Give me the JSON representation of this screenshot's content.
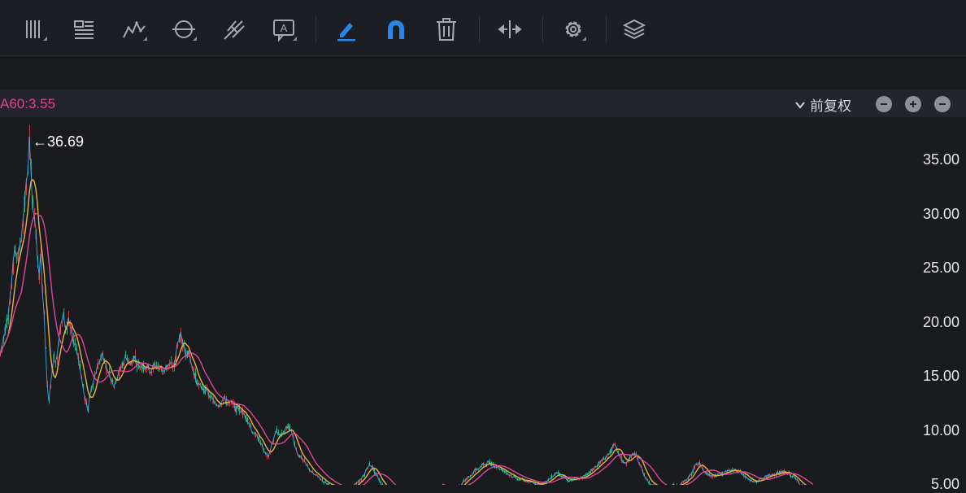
{
  "toolbar": {
    "tools": [
      {
        "name": "vertical-lines-icon",
        "has_menu": true
      },
      {
        "name": "text-lines-icon",
        "has_menu": false
      },
      {
        "name": "polyline-icon",
        "has_menu": true
      },
      {
        "name": "circle-icon",
        "has_menu": true
      },
      {
        "name": "fork-icon",
        "has_menu": false
      },
      {
        "name": "text-annotation-icon",
        "has_menu": true
      },
      {
        "name": "pen-icon",
        "has_menu": false,
        "active": true
      },
      {
        "name": "magnet-icon",
        "has_menu": false,
        "active": true
      },
      {
        "name": "trash-icon",
        "has_menu": false
      },
      {
        "name": "split-arrows-icon",
        "has_menu": false
      },
      {
        "name": "gear-icon",
        "has_menu": true
      },
      {
        "name": "layers-icon",
        "has_menu": false
      }
    ],
    "active_color": "#2a87e8",
    "icon_color": "#a6a8b0"
  },
  "indicator_bar": {
    "ma60_label": "A60:3.55",
    "ma60_color": "#e0459a",
    "adjust_label": "前复权",
    "buttons": [
      "minus-circle-icon",
      "plus-circle-icon",
      "minus-circle-icon"
    ]
  },
  "chart_data": {
    "type": "candlestick",
    "peak_label": "←36.69",
    "yaxis_ticks": [
      "35.00",
      "30.00",
      "25.00",
      "20.00",
      "15.00",
      "10.00",
      "5.00"
    ],
    "ylim": [
      4.5,
      38.5
    ],
    "series": [
      {
        "color": "#e0459a"
      },
      {
        "color": "#e6b43c"
      },
      {
        "color": "#3fa3e8"
      }
    ],
    "price_path": [
      [
        0,
        17
      ],
      [
        5,
        19
      ],
      [
        10,
        21
      ],
      [
        15,
        24
      ],
      [
        18,
        27
      ],
      [
        22,
        26
      ],
      [
        26,
        28
      ],
      [
        30,
        31
      ],
      [
        33,
        33
      ],
      [
        36,
        36.69
      ],
      [
        39,
        32
      ],
      [
        42,
        30
      ],
      [
        45,
        27
      ],
      [
        48,
        24
      ],
      [
        50,
        26
      ],
      [
        53,
        22
      ],
      [
        56,
        18
      ],
      [
        58,
        14
      ],
      [
        60,
        13
      ],
      [
        63,
        15
      ],
      [
        66,
        17
      ],
      [
        69,
        16
      ],
      [
        72,
        18
      ],
      [
        75,
        20
      ],
      [
        78,
        21
      ],
      [
        81,
        19
      ],
      [
        84,
        20
      ],
      [
        88,
        19
      ],
      [
        92,
        18
      ],
      [
        96,
        17
      ],
      [
        100,
        15
      ],
      [
        104,
        13
      ],
      [
        108,
        12
      ],
      [
        112,
        14
      ],
      [
        116,
        15
      ],
      [
        120,
        16
      ],
      [
        125,
        17
      ],
      [
        130,
        16
      ],
      [
        135,
        15
      ],
      [
        140,
        14
      ],
      [
        145,
        15
      ],
      [
        150,
        16
      ],
      [
        155,
        17
      ],
      [
        160,
        16
      ],
      [
        165,
        17
      ],
      [
        170,
        16
      ],
      [
        175,
        16
      ],
      [
        180,
        16
      ],
      [
        185,
        15.5
      ],
      [
        190,
        16
      ],
      [
        195,
        16
      ],
      [
        200,
        15.5
      ],
      [
        205,
        16
      ],
      [
        210,
        16
      ],
      [
        215,
        16
      ],
      [
        218,
        18
      ],
      [
        221,
        19
      ],
      [
        224,
        18
      ],
      [
        228,
        17.5
      ],
      [
        232,
        17
      ],
      [
        236,
        16
      ],
      [
        240,
        15
      ],
      [
        245,
        14
      ],
      [
        250,
        14
      ],
      [
        255,
        13.5
      ],
      [
        260,
        13
      ],
      [
        265,
        12.5
      ],
      [
        270,
        12.5
      ],
      [
        275,
        13
      ],
      [
        280,
        12.5
      ],
      [
        285,
        12.5
      ],
      [
        290,
        12
      ],
      [
        295,
        12
      ],
      [
        300,
        11.5
      ],
      [
        305,
        11
      ],
      [
        310,
        10
      ],
      [
        315,
        9.5
      ],
      [
        320,
        9
      ],
      [
        325,
        8
      ],
      [
        330,
        7.5
      ],
      [
        335,
        9
      ],
      [
        340,
        10
      ],
      [
        345,
        9.5
      ],
      [
        350,
        10
      ],
      [
        355,
        10.5
      ],
      [
        360,
        9.5
      ],
      [
        365,
        8
      ],
      [
        370,
        7.5
      ],
      [
        375,
        7
      ],
      [
        380,
        6.5
      ],
      [
        385,
        6
      ],
      [
        390,
        5.8
      ],
      [
        395,
        5.5
      ],
      [
        400,
        5.2
      ],
      [
        405,
        5
      ],
      [
        410,
        4.8
      ],
      [
        415,
        4.7
      ],
      [
        420,
        4.6
      ],
      [
        425,
        4.6
      ],
      [
        430,
        4.7
      ],
      [
        435,
        4.9
      ],
      [
        440,
        5.2
      ],
      [
        445,
        5.6
      ],
      [
        450,
        6.3
      ],
      [
        455,
        7
      ],
      [
        460,
        6.3
      ],
      [
        465,
        5.6
      ],
      [
        470,
        5
      ],
      [
        475,
        4.7
      ],
      [
        480,
        4.6
      ],
      [
        485,
        4.6
      ],
      [
        490,
        4.5
      ],
      [
        500,
        4.5
      ],
      [
        510,
        4.5
      ],
      [
        520,
        4.5
      ],
      [
        530,
        4.6
      ],
      [
        540,
        4.7
      ],
      [
        545,
        5
      ],
      [
        550,
        4.8
      ],
      [
        555,
        4.6
      ],
      [
        560,
        4.7
      ],
      [
        565,
        4.9
      ],
      [
        570,
        5.3
      ],
      [
        575,
        5.6
      ],
      [
        580,
        6
      ],
      [
        585,
        6.4
      ],
      [
        590,
        6.6
      ],
      [
        595,
        6.9
      ],
      [
        600,
        7.1
      ],
      [
        605,
        6.9
      ],
      [
        610,
        6.7
      ],
      [
        615,
        6.5
      ],
      [
        620,
        6.3
      ],
      [
        625,
        6
      ],
      [
        630,
        5.8
      ],
      [
        635,
        5.6
      ],
      [
        640,
        5.5
      ],
      [
        645,
        5.4
      ],
      [
        650,
        5.3
      ],
      [
        655,
        5.2
      ],
      [
        660,
        5.1
      ],
      [
        665,
        5.1
      ],
      [
        670,
        5.2
      ],
      [
        675,
        5.5
      ],
      [
        680,
        5.9
      ],
      [
        685,
        6.2
      ],
      [
        690,
        5.9
      ],
      [
        695,
        5.6
      ],
      [
        700,
        5.4
      ],
      [
        705,
        5.5
      ],
      [
        710,
        5.6
      ],
      [
        715,
        5.6
      ],
      [
        720,
        5.9
      ],
      [
        725,
        6.2
      ],
      [
        730,
        6.5
      ],
      [
        735,
        6.9
      ],
      [
        740,
        7.2
      ],
      [
        745,
        7.6
      ],
      [
        750,
        8
      ],
      [
        755,
        8.7
      ],
      [
        760,
        8
      ],
      [
        765,
        7.2
      ],
      [
        770,
        7
      ],
      [
        775,
        7.5
      ],
      [
        780,
        8
      ],
      [
        785,
        7.2
      ],
      [
        790,
        6.3
      ],
      [
        795,
        5.5
      ],
      [
        800,
        5
      ],
      [
        805,
        4.9
      ],
      [
        810,
        4.8
      ],
      [
        815,
        4.8
      ],
      [
        820,
        4.8
      ],
      [
        825,
        4.9
      ],
      [
        830,
        5
      ],
      [
        835,
        5
      ],
      [
        840,
        5.2
      ],
      [
        845,
        5.5
      ],
      [
        850,
        6
      ],
      [
        855,
        6.8
      ],
      [
        860,
        7
      ],
      [
        865,
        6.4
      ],
      [
        870,
        6
      ],
      [
        875,
        5.8
      ],
      [
        880,
        5.9
      ],
      [
        885,
        6
      ],
      [
        890,
        6.1
      ],
      [
        895,
        6.3
      ],
      [
        900,
        6.3
      ],
      [
        905,
        6.4
      ],
      [
        910,
        6.2
      ],
      [
        915,
        5.9
      ],
      [
        920,
        5.5
      ],
      [
        925,
        5.3
      ],
      [
        930,
        5.3
      ],
      [
        935,
        5.5
      ],
      [
        940,
        5.7
      ],
      [
        945,
        5.8
      ],
      [
        950,
        6
      ],
      [
        955,
        6.1
      ],
      [
        960,
        6.1
      ],
      [
        965,
        6.2
      ],
      [
        970,
        6
      ],
      [
        975,
        5.8
      ],
      [
        980,
        5.4
      ],
      [
        985,
        5
      ],
      [
        990,
        4.8
      ],
      [
        995,
        4.6
      ],
      [
        1000,
        4.5
      ]
    ]
  }
}
